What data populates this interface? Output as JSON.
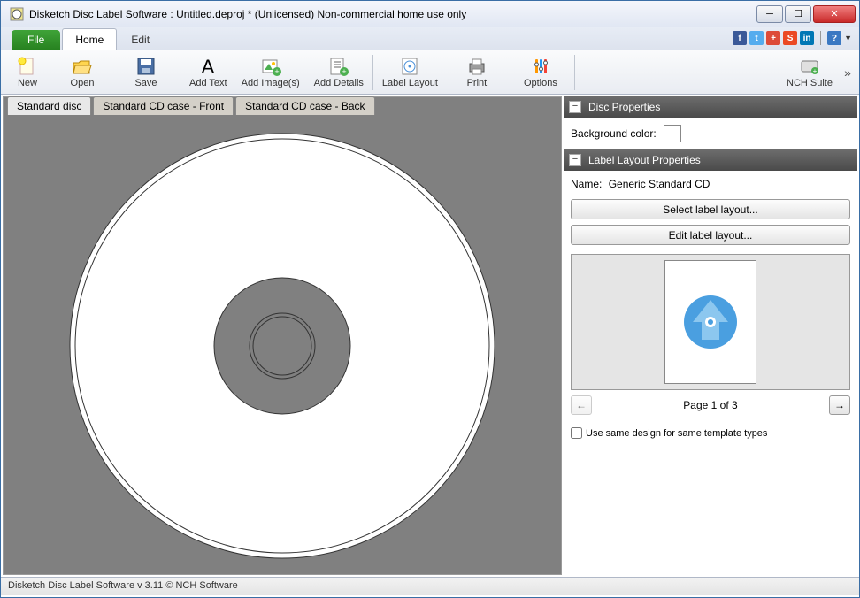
{
  "window": {
    "title": "Disketch Disc Label Software : Untitled.deproj * (Unlicensed) Non-commercial home use only"
  },
  "ribbon": {
    "file": "File",
    "tabs": [
      {
        "label": "Home",
        "active": true
      },
      {
        "label": "Edit",
        "active": false
      }
    ]
  },
  "toolbar": {
    "new": "New",
    "open": "Open",
    "save": "Save",
    "add_text": "Add Text",
    "add_images": "Add Image(s)",
    "add_details": "Add Details",
    "label_layout": "Label Layout",
    "print": "Print",
    "options": "Options",
    "nch_suite": "NCH Suite"
  },
  "doc_tabs": [
    {
      "label": "Standard disc",
      "active": true
    },
    {
      "label": "Standard CD case - Front",
      "active": false
    },
    {
      "label": "Standard CD case - Back",
      "active": false
    }
  ],
  "disc_props": {
    "header": "Disc Properties",
    "bg_label": "Background color:",
    "bg_color": "#ffffff"
  },
  "layout_props": {
    "header": "Label Layout Properties",
    "name_label": "Name:",
    "name_value": "Generic Standard CD",
    "select_btn": "Select label layout...",
    "edit_btn": "Edit label layout...",
    "page_text": "Page 1 of 3",
    "checkbox_label": "Use same design for same template types"
  },
  "status": {
    "text": "Disketch Disc Label Software v 3.11 © NCH Software"
  },
  "social_icons": [
    "facebook",
    "twitter",
    "google-plus",
    "stumbleupon",
    "linkedin"
  ]
}
